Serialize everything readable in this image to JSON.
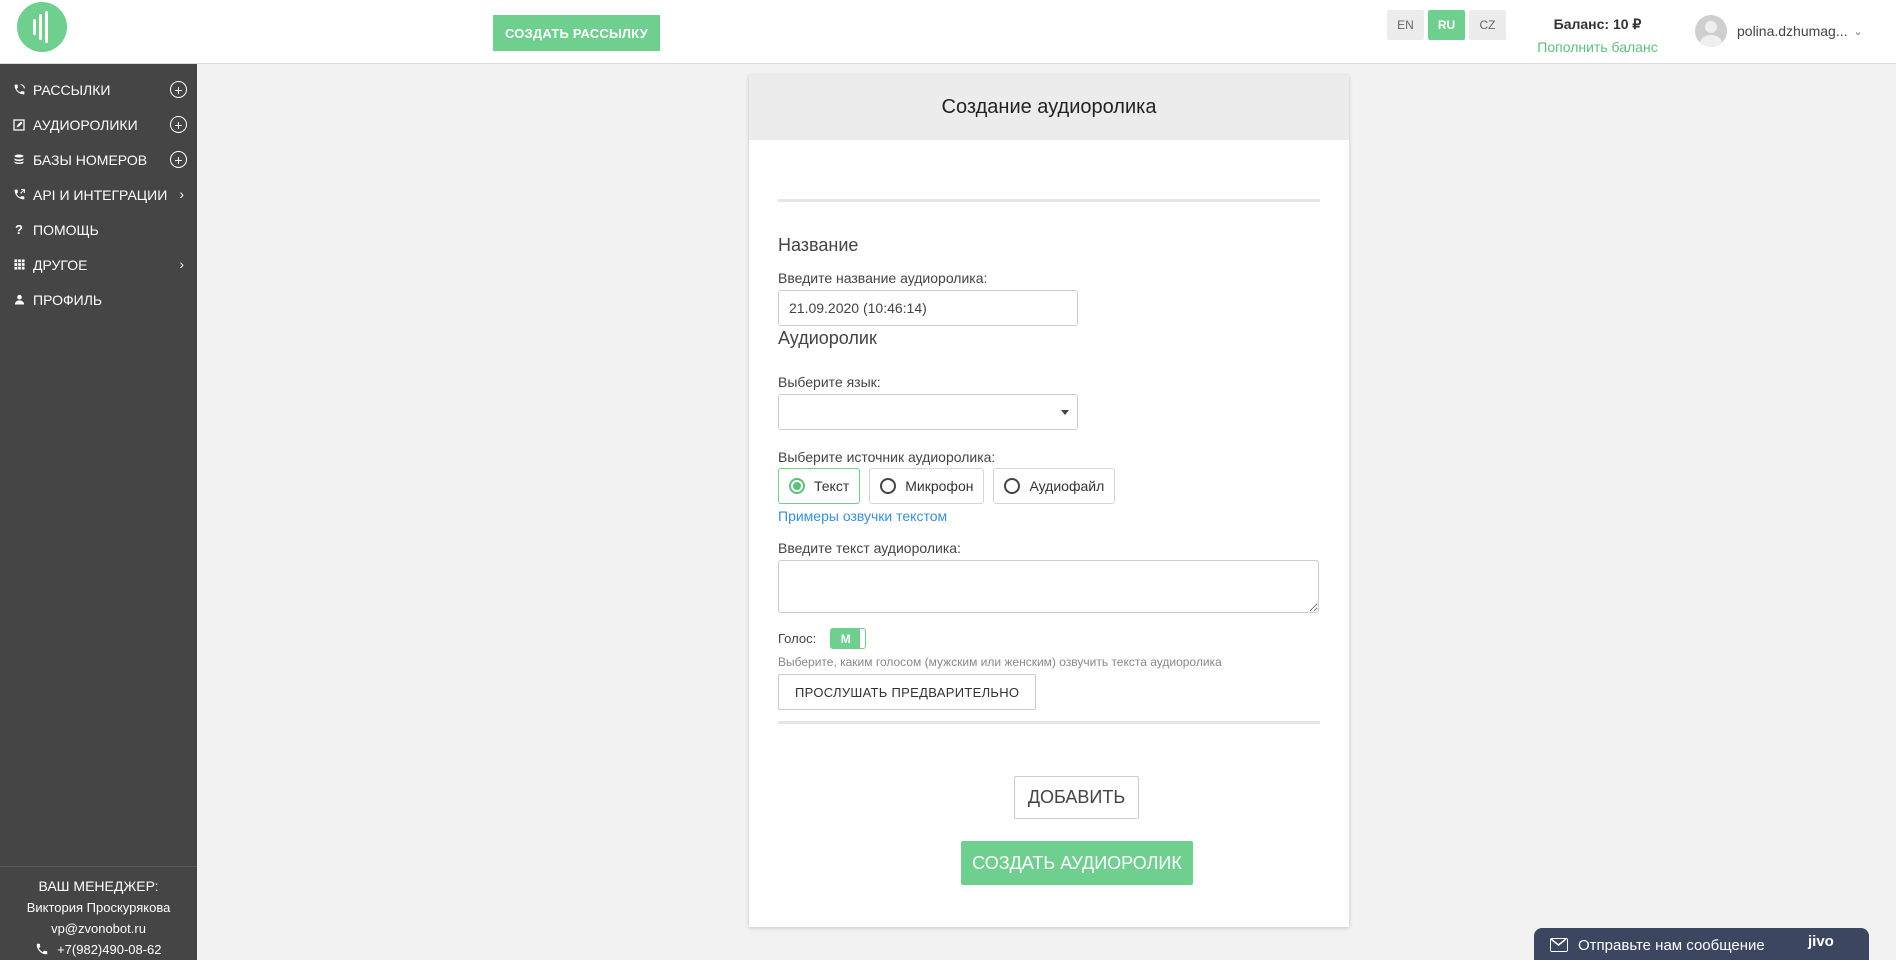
{
  "header": {
    "create_mailing_label": "СОЗДАТЬ РАССЫЛКУ",
    "languages": [
      {
        "code": "EN",
        "active": false
      },
      {
        "code": "RU",
        "active": true
      },
      {
        "code": "CZ",
        "active": false
      }
    ],
    "balance_label": "Баланс: 10 ₽",
    "topup_label": "Пополнить баланс",
    "user_name": "polina.dzhumag...",
    "brand_color": "#6fcf8f"
  },
  "sidebar": {
    "items": [
      {
        "label": "РАССЫЛКИ",
        "icon": "phone-call-icon",
        "action": "add"
      },
      {
        "label": "АУДИОРОЛИКИ",
        "icon": "edit-icon",
        "action": "add"
      },
      {
        "label": "БАЗЫ НОМЕРОВ",
        "icon": "database-icon",
        "action": "add"
      },
      {
        "label": "API И ИНТЕГРАЦИИ",
        "icon": "phone-forward-icon",
        "action": "chevron"
      },
      {
        "label": "ПОМОЩЬ",
        "icon": "question-icon",
        "action": "none"
      },
      {
        "label": "ДРУГОЕ",
        "icon": "grid-icon",
        "action": "chevron"
      },
      {
        "label": "ПРОФИЛЬ",
        "icon": "user-icon",
        "action": "none"
      }
    ],
    "manager": {
      "title": "ВАШ МЕНЕДЖЕР:",
      "name": "Виктория Проскурякова",
      "email": "vp@zvonobot.ru",
      "phone": "+7(982)490-08-62"
    }
  },
  "form": {
    "title": "Создание аудиоролика",
    "name_section": "Название",
    "name_label": "Введите название аудиоролика:",
    "name_value": "21.09.2020 (10:46:14)",
    "audio_section": "Аудиоролик",
    "language_label": "Выберите язык:",
    "language_value": "",
    "source_label": "Выберите источник аудиоролика:",
    "sources": [
      {
        "label": "Текст",
        "selected": true
      },
      {
        "label": "Микрофон",
        "selected": false
      },
      {
        "label": "Аудиофайл",
        "selected": false
      }
    ],
    "examples_link": "Примеры озвучки текстом",
    "text_label": "Введите текст аудиоролика:",
    "text_value": "",
    "voice_label": "Голос:",
    "voice_value": "М",
    "voice_hint": "Выберите, каким голосом (мужским или женским) озвучить текста аудиоролика",
    "preview_label": "ПРОСЛУШАТЬ ПРЕДВАРИТЕЛЬНО",
    "add_label": "ДОБАВИТЬ",
    "create_label": "СОЗДАТЬ АУДИОРОЛИК"
  },
  "chat": {
    "text": "Отправьте нам сообщение",
    "brand": "jivo"
  }
}
